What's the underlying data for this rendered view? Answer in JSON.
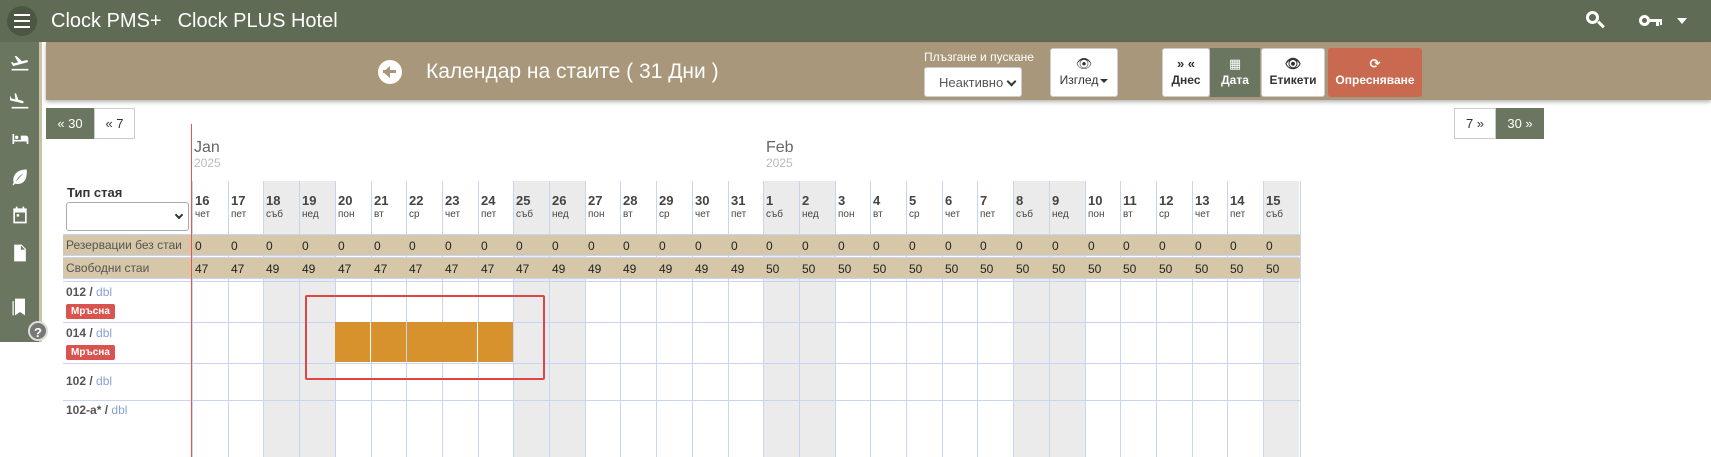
{
  "app": {
    "title": "Clock PMS+",
    "hotel": "Clock PLUS Hotel"
  },
  "header": {
    "title": "Календар на стаите ( 31 Дни )",
    "drag_label": "Плъзгане и пускане",
    "drag_value": "Неактивно",
    "view_label": "Изглед",
    "today_label": "Днес",
    "today_icon": "» «",
    "date_label": "Дата",
    "labels_label": "Етикети",
    "refresh_label": "Опресняване"
  },
  "pager": {
    "back30": "« 30",
    "back7": "« 7",
    "fwd7": "7 »",
    "fwd30": "30 »"
  },
  "months": [
    {
      "name": "Jan",
      "year": "2025"
    },
    {
      "name": "Feb",
      "year": "2025"
    }
  ],
  "room_type_label": "Тип стая",
  "days": [
    {
      "n": "16",
      "w": "чет",
      "we": false
    },
    {
      "n": "17",
      "w": "пет",
      "we": false
    },
    {
      "n": "18",
      "w": "съб",
      "we": true
    },
    {
      "n": "19",
      "w": "нед",
      "we": true
    },
    {
      "n": "20",
      "w": "пон",
      "we": false
    },
    {
      "n": "21",
      "w": "вт",
      "we": false
    },
    {
      "n": "22",
      "w": "ср",
      "we": false
    },
    {
      "n": "23",
      "w": "чет",
      "we": false
    },
    {
      "n": "24",
      "w": "пет",
      "we": false
    },
    {
      "n": "25",
      "w": "съб",
      "we": true
    },
    {
      "n": "26",
      "w": "нед",
      "we": true
    },
    {
      "n": "27",
      "w": "пон",
      "we": false
    },
    {
      "n": "28",
      "w": "вт",
      "we": false
    },
    {
      "n": "29",
      "w": "ср",
      "we": false
    },
    {
      "n": "30",
      "w": "чет",
      "we": false
    },
    {
      "n": "31",
      "w": "пет",
      "we": false
    },
    {
      "n": "1",
      "w": "съб",
      "we": true
    },
    {
      "n": "2",
      "w": "нед",
      "we": true
    },
    {
      "n": "3",
      "w": "пон",
      "we": false
    },
    {
      "n": "4",
      "w": "вт",
      "we": false
    },
    {
      "n": "5",
      "w": "ср",
      "we": false
    },
    {
      "n": "6",
      "w": "чет",
      "we": false
    },
    {
      "n": "7",
      "w": "пет",
      "we": false
    },
    {
      "n": "8",
      "w": "съб",
      "we": true
    },
    {
      "n": "9",
      "w": "нед",
      "we": true
    },
    {
      "n": "10",
      "w": "пон",
      "we": false
    },
    {
      "n": "11",
      "w": "вт",
      "we": false
    },
    {
      "n": "12",
      "w": "ср",
      "we": false
    },
    {
      "n": "13",
      "w": "чет",
      "we": false
    },
    {
      "n": "14",
      "w": "пет",
      "we": false
    },
    {
      "n": "15",
      "w": "съб",
      "we": true
    }
  ],
  "summary": [
    {
      "label": "Резервации без стаи",
      "values": [
        "0",
        "0",
        "0",
        "0",
        "0",
        "0",
        "0",
        "0",
        "0",
        "0",
        "0",
        "0",
        "0",
        "0",
        "0",
        "0",
        "0",
        "0",
        "0",
        "0",
        "0",
        "0",
        "0",
        "0",
        "0",
        "0",
        "0",
        "0",
        "0",
        "0",
        "0"
      ]
    },
    {
      "label": "Свободни стаи",
      "values": [
        "47",
        "47",
        "49",
        "49",
        "47",
        "47",
        "47",
        "47",
        "47",
        "47",
        "49",
        "49",
        "49",
        "49",
        "49",
        "49",
        "50",
        "50",
        "50",
        "50",
        "50",
        "50",
        "50",
        "50",
        "50",
        "50",
        "50",
        "50",
        "50",
        "50",
        "50"
      ]
    }
  ],
  "rooms": [
    {
      "number": "012",
      "type": "dbl",
      "badge": "Мръсна"
    },
    {
      "number": "014",
      "type": "dbl",
      "badge": "Мръсна"
    },
    {
      "number": "102",
      "type": "dbl",
      "badge": ""
    },
    {
      "number": "102-a*",
      "type": "dbl",
      "badge": ""
    }
  ],
  "booking": {
    "room": "014",
    "from_day": "20",
    "to_day": "24",
    "color": "#d8922d"
  },
  "colors": {
    "topbar": "#5f6b54",
    "band": "#a8977a",
    "refresh": "#c9694f",
    "badge": "#d9534f"
  }
}
